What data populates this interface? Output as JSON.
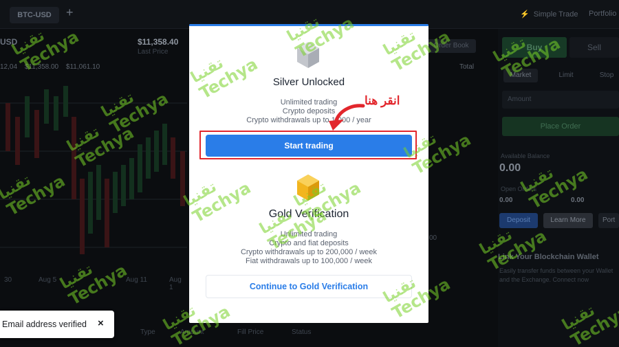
{
  "app": {
    "pair_tab": "BTC-USD",
    "simple_trade": "Simple Trade",
    "portfolio": "Portfolio"
  },
  "market": {
    "pair": "USD",
    "last_price": "$11,358.40",
    "last_price_label": "Last Price",
    "ohlc": [
      "12,04",
      "$11,358.00",
      "$11,061.10"
    ],
    "orderbook_button": "Order Book",
    "total_label": "Total",
    "mid_value": "00",
    "x_ticks": [
      "30",
      "Aug 5",
      "Aug 11",
      "Aug 1"
    ],
    "bottom_tabs": [
      "Type",
      "Amount",
      "Fill Price",
      "Status"
    ]
  },
  "trade_panel": {
    "buy": "Buy",
    "sell": "Sell",
    "order_types": [
      "Market",
      "Limit",
      "Stop"
    ],
    "amount_placeholder": "Amount",
    "place_order": "Place Order",
    "available_label": "Available Balance",
    "available_value": "0.00",
    "open_orders_label": "Open Orders",
    "open_orders_value": "0.00",
    "total_value": "0.00",
    "deposit": "Deposit",
    "learn_more": "Learn More",
    "port": "Port",
    "link_title": "Link Your Blockchain Wallet",
    "link_desc": "Easily transfer funds between your Wallet and the Exchange. Connect now"
  },
  "toast": {
    "text": "Email address verified",
    "close": "×"
  },
  "modal": {
    "silver": {
      "title": "Silver Unlocked",
      "benefits": [
        "Unlimited trading",
        "Crypto deposits",
        "Crypto withdrawals up to 1,000 / year"
      ],
      "button": "Start trading"
    },
    "gold": {
      "title": "Gold Verification",
      "benefits": [
        "Unlimited trading",
        "Crypto and fiat deposits",
        "Crypto withdrawals up to 200,000 / week",
        "Fiat withdrawals up to 100,000 / week"
      ],
      "button": "Continue to Gold Verification"
    }
  },
  "annotation": {
    "text": "انقر هنا",
    "color": "#e2262c"
  },
  "watermark": {
    "arabic": "تقنيا",
    "latin": "Techya",
    "color": "#78d228"
  },
  "colors": {
    "accent": "#2a7de8",
    "silver_icon": "#b9bcc2",
    "gold_icon": "#f2b51e"
  }
}
